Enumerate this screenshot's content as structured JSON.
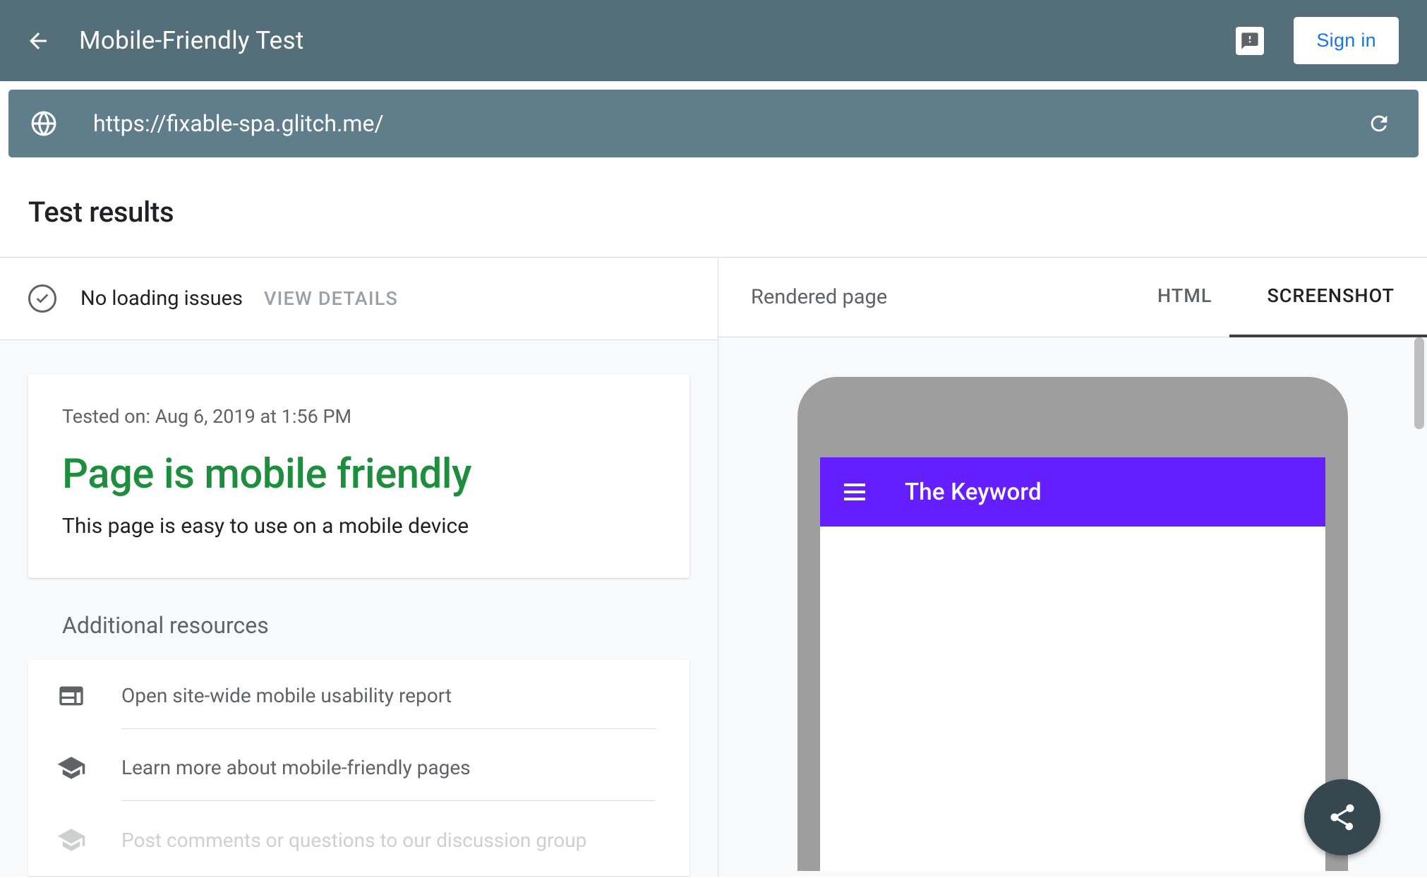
{
  "header": {
    "title": "Mobile-Friendly Test",
    "signin_label": "Sign in"
  },
  "url_bar": {
    "url": "https://fixable-spa.glitch.me/"
  },
  "results": {
    "section_title": "Test results",
    "loading_status": "No loading issues",
    "view_details_label": "VIEW DETAILS",
    "tested_on": "Tested on: Aug 6, 2019 at 1:56 PM",
    "heading": "Page is mobile friendly",
    "subtext": "This page is easy to use on a mobile device"
  },
  "resources": {
    "title": "Additional resources",
    "items": [
      "Open site-wide mobile usability report",
      "Learn more about mobile-friendly pages",
      "Post comments or questions to our discussion group"
    ]
  },
  "rendered": {
    "title": "Rendered page",
    "tabs": {
      "html": "HTML",
      "screenshot": "SCREENSHOT"
    }
  },
  "preview": {
    "site_title": "The Keyword"
  }
}
